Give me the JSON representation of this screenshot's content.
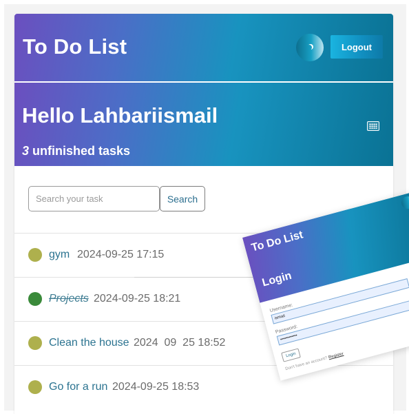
{
  "header": {
    "title": "To Do List",
    "theme_toggle_icon": "moon-icon",
    "logout_label": "Logout"
  },
  "hero": {
    "greeting": "Hello Lahbariismail",
    "unfinished_count": "3",
    "unfinished_label": "unfinished tasks",
    "calendar_icon": "calendar-icon"
  },
  "search": {
    "placeholder": "Search your task",
    "value": "",
    "button_label": "Search"
  },
  "tasks": [
    {
      "name": "gym",
      "datetime": "2024-09-25 17:15",
      "status_color": "#aeb04d",
      "completed": false
    },
    {
      "name": "Projects",
      "datetime": "2024-09-25 18:21",
      "status_color": "#3a8a3a",
      "completed": true
    },
    {
      "name": "Clean the house",
      "datetime": "2024  09  25 18:52",
      "status_color": "#aeb04d",
      "completed": false
    },
    {
      "name": "Go for a run",
      "datetime": "2024-09-25 18:53",
      "status_color": "#aeb04d",
      "completed": false
    }
  ],
  "login_card": {
    "app_title": "To Do List",
    "title": "Login",
    "username_label": "Username:",
    "username_value": "ismail",
    "password_label": "Password:",
    "password_value": "••••••••••••",
    "login_button": "Login",
    "register_prompt": "Don't have an account?",
    "register_link": "Register"
  },
  "colors": {
    "gradient_start": "#6b4fbf",
    "gradient_mid": "#1893bf",
    "gradient_end": "#0a7294",
    "task_text": "#2b7390",
    "pending_dot": "#aeb04d",
    "done_dot": "#3a8a3a"
  }
}
